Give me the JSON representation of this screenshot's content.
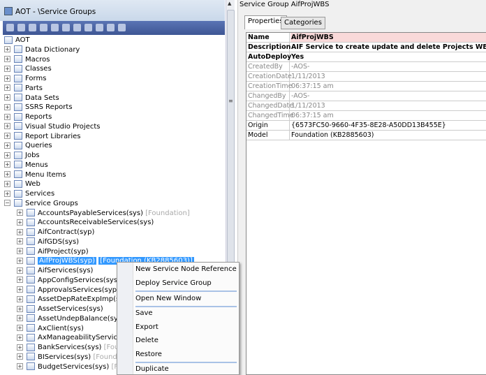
{
  "left": {
    "title": "AOT - \\Service Groups",
    "tree_root": "AOT",
    "top_items": [
      "Data Dictionary",
      "Macros",
      "Classes",
      "Forms",
      "Parts",
      "Data Sets",
      "SSRS Reports",
      "Reports",
      "Visual Studio Projects",
      "Report Libraries",
      "Queries",
      "Jobs",
      "Menus",
      "Menu Items",
      "Web",
      "Services",
      "Service Groups"
    ],
    "children": [
      {
        "label": "AccountsPayableServices(sys)",
        "layer": "[Foundation]"
      },
      {
        "label": "AccountsReceivableServices(sys)",
        "layer": ""
      },
      {
        "label": "AifContract(syp)",
        "layer": ""
      },
      {
        "label": "AifGDS(sys)",
        "layer": ""
      },
      {
        "label": "AifProject(syp)",
        "layer": ""
      },
      {
        "label": "AifProjWBS(syp)",
        "layer": "[Foundation (KB2885603)]",
        "selected": true
      },
      {
        "label": "AifServices(sys)",
        "layer": ""
      },
      {
        "label": "AppConfigServices(sys)",
        "layer": ""
      },
      {
        "label": "ApprovalsServices(syp)",
        "layer": ""
      },
      {
        "label": "AssetDepRateExpImp(syp)",
        "layer": ""
      },
      {
        "label": "AssetServices(sys)",
        "layer": ""
      },
      {
        "label": "AssetUndepBalance(syp)",
        "layer": ""
      },
      {
        "label": "AxClient(sys)",
        "layer": ""
      },
      {
        "label": "AxManageabilityServiceGro",
        "layer": ""
      },
      {
        "label": "BankServices(sys)",
        "layer": "[Founda"
      },
      {
        "label": "BIServices(sys)",
        "layer": "[Foundation"
      },
      {
        "label": "BudgetServices(sys)",
        "layer": "[Foun"
      }
    ]
  },
  "right": {
    "title": "Service Group AifProjWBS",
    "tabs": [
      "Properties",
      "Categories"
    ],
    "properties": [
      {
        "k": "Name",
        "v": "AifProjWBS",
        "style": "b hl"
      },
      {
        "k": "Description",
        "v": "AIF Service to create update and delete Projects WBS",
        "style": "b"
      },
      {
        "k": "AutoDeploy",
        "v": "Yes",
        "style": "b"
      },
      {
        "k": "CreatedBy",
        "v": "-AOS-",
        "style": "g"
      },
      {
        "k": "CreationDate",
        "v": "1/11/2013",
        "style": "g"
      },
      {
        "k": "CreationTime",
        "v": "06:37:15 am",
        "style": "g"
      },
      {
        "k": "ChangedBy",
        "v": "-AOS-",
        "style": "g"
      },
      {
        "k": "ChangedDate",
        "v": "1/11/2013",
        "style": "g"
      },
      {
        "k": "ChangedTime",
        "v": "06:37:15 am",
        "style": "g"
      },
      {
        "k": "Origin",
        "v": "{6573FC50-9660-4F35-8E28-A50DD13B455E}",
        "style": ""
      },
      {
        "k": "Model",
        "v": "Foundation (KB2885603)",
        "style": ""
      }
    ]
  },
  "context_menu": [
    "New Service Node Reference",
    "Deploy Service Group",
    "Open New Window",
    "Save",
    "Export",
    "Delete",
    "Restore",
    "Duplicate"
  ]
}
